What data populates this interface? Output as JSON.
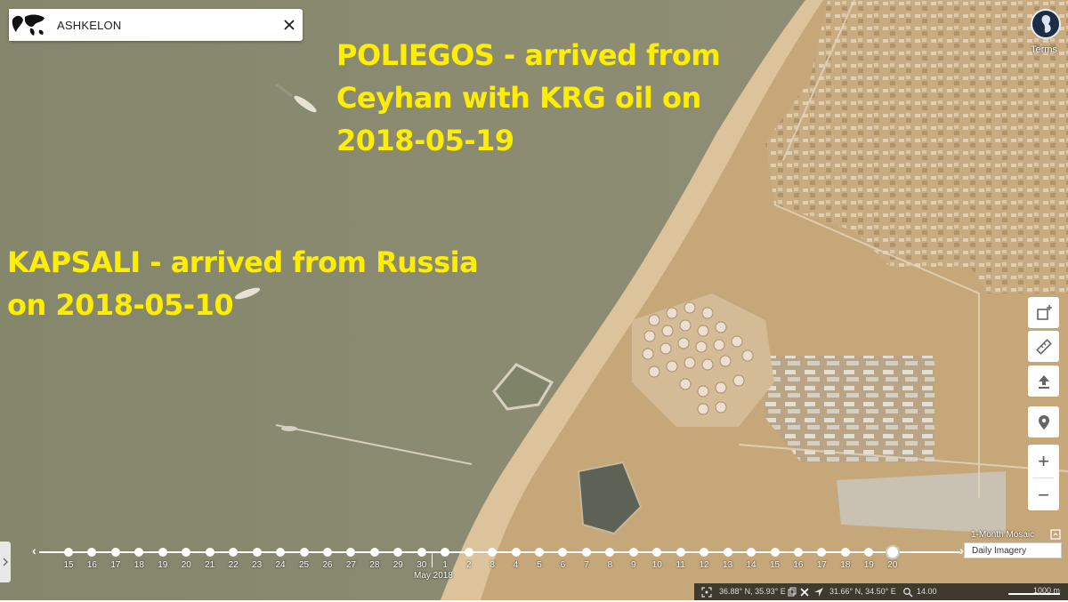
{
  "search": {
    "query": "ASHKELON",
    "close_icon": "close-icon",
    "globe_icon": "world-map-icon"
  },
  "annotations": {
    "poliegos": [
      "POLIEGOS - arrived from",
      "Ceyhan with KRG oil on",
      "2018-05-19"
    ],
    "kapsali": [
      "KAPSALI - arrived from Russia",
      "on 2018-05-10"
    ]
  },
  "account": {
    "icon": "user-avatar-icon",
    "terms_label": "Terms"
  },
  "tools": [
    {
      "name": "draw-area-tool",
      "icon": "square-plus-icon"
    },
    {
      "name": "measure-tool",
      "icon": "ruler-icon"
    },
    {
      "name": "upload-tool",
      "icon": "upload-icon"
    },
    {
      "name": "place-marker-tool",
      "icon": "location-pin-icon"
    }
  ],
  "zoom": {
    "in_label": "+",
    "out_label": "−"
  },
  "timeline": {
    "days": [
      "15",
      "16",
      "17",
      "18",
      "19",
      "20",
      "21",
      "22",
      "23",
      "24",
      "25",
      "26",
      "27",
      "28",
      "29",
      "30",
      "1",
      "2",
      "3",
      "4",
      "5",
      "6",
      "7",
      "8",
      "9",
      "10",
      "11",
      "12",
      "13",
      "14",
      "15",
      "16",
      "17",
      "18",
      "19",
      "20"
    ],
    "selected_index": 35,
    "month_label": "May 2018",
    "mosaic_label": "1-Month Mosaic",
    "imagery_type": "Daily Imagery"
  },
  "status_bar": {
    "coords_left": "36.88° N, 35.93° E",
    "coords_right": "31.66° N, 34.50° E",
    "zoom_level": "14.00",
    "scale_label": "1000 m"
  },
  "colors": {
    "annotation": "#ffee00",
    "sea": "#8a8c72",
    "land": "#c9a97a"
  }
}
